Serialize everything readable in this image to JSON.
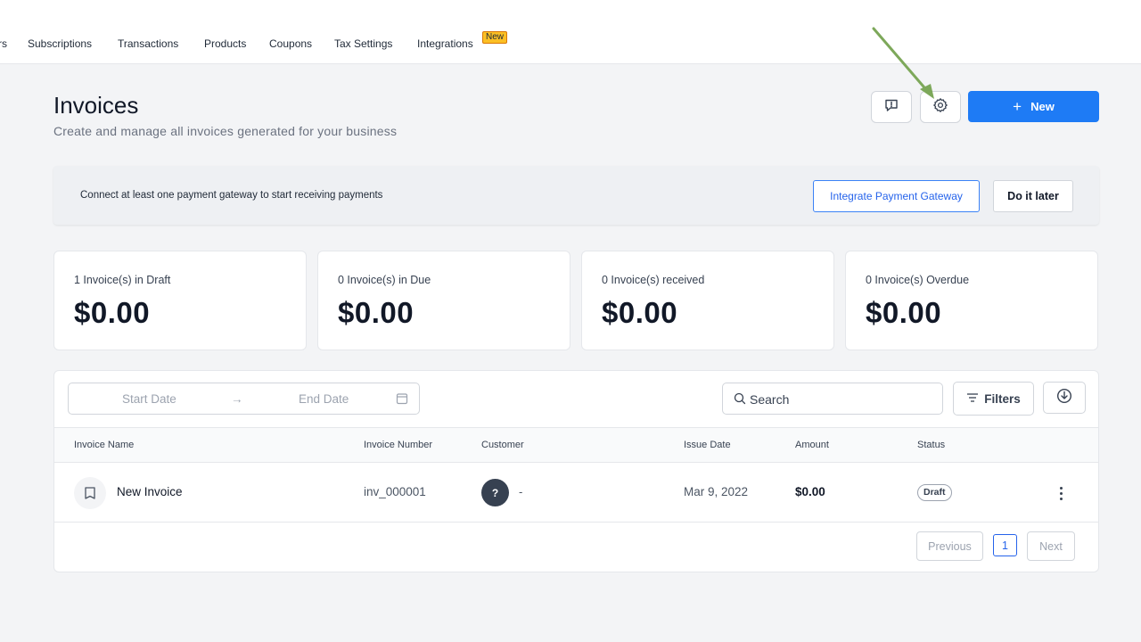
{
  "nav": {
    "items": [
      {
        "label": "rs"
      },
      {
        "label": "Subscriptions"
      },
      {
        "label": "Transactions"
      },
      {
        "label": "Products"
      },
      {
        "label": "Coupons"
      },
      {
        "label": "Tax Settings"
      },
      {
        "label": "Integrations"
      }
    ],
    "new_badge": "New"
  },
  "header": {
    "title": "Invoices",
    "subtitle": "Create and manage all invoices generated for your business",
    "new_button": "New",
    "new_button_icon": "+"
  },
  "banner": {
    "text": "Connect at least one payment gateway to start receiving payments",
    "integrate_label": "Integrate Payment Gateway",
    "later_label": "Do it later"
  },
  "stats": [
    {
      "label": "1 Invoice(s) in Draft",
      "value": "$0.00"
    },
    {
      "label": "0 Invoice(s) in Due",
      "value": "$0.00"
    },
    {
      "label": "0 Invoice(s) received",
      "value": "$0.00"
    },
    {
      "label": "0 Invoice(s) Overdue",
      "value": "$0.00"
    }
  ],
  "toolbar": {
    "start_date": "Start Date",
    "end_date": "End Date",
    "arrow": "→",
    "search_placeholder": "Search",
    "filters_label": "Filters"
  },
  "table": {
    "columns": [
      "Invoice Name",
      "Invoice Number",
      "Customer",
      "Issue Date",
      "Amount",
      "Status"
    ],
    "rows": [
      {
        "name": "New Invoice",
        "number": "inv_000001",
        "customer_initial": "?",
        "customer": "-",
        "issue_date": "Mar 9, 2022",
        "amount": "$0.00",
        "status": "Draft"
      }
    ]
  },
  "pagination": {
    "previous": "Previous",
    "page": "1",
    "next": "Next"
  },
  "colors": {
    "accent": "#1e7bf5",
    "badge": "#fbbf24",
    "arrow_annotation": "#7da85a"
  }
}
